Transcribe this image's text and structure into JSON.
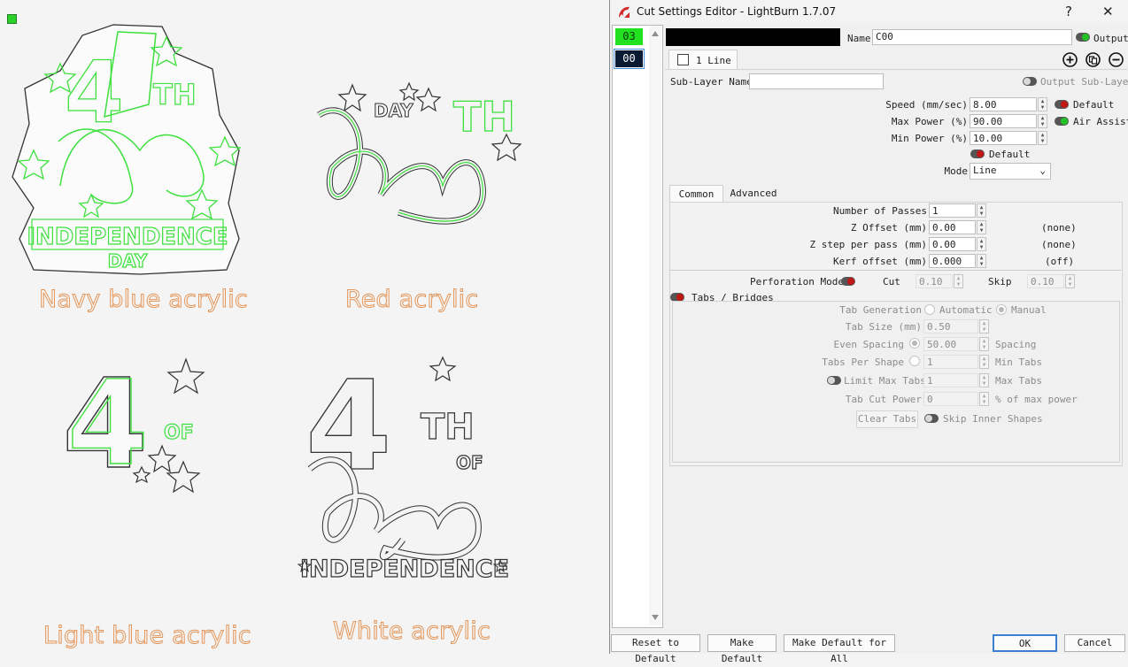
{
  "canvas": {
    "captions": [
      "Navy blue acrylic",
      "Red acrylic",
      "Light blue acrylic",
      "White acrylic"
    ],
    "art": {
      "d1_independence": "INDEPENDENCE",
      "d1_day": "DAY",
      "d1_th": "TH",
      "d2_day": "DAY",
      "d2_th": "TH",
      "d3_of": "OF",
      "d4_th": "TH",
      "d4_of": "OF",
      "d4_independence": "INDEPENDENCE",
      "numeral": "4",
      "script": "July"
    }
  },
  "dialog": {
    "title": "Cut Settings Editor - LightBurn 1.7.07",
    "help_label": "?",
    "close_label": "✕",
    "layers": [
      {
        "label": "03",
        "color": "#22e11f"
      },
      {
        "label": "00",
        "color": "#0a1a33"
      }
    ],
    "name_label": "Name",
    "name_value": "C00",
    "output_label": "Output",
    "sublayer_tab": "1 Line",
    "sublayer_name_label": "Sub-Layer Name",
    "sublayer_name_value": "",
    "output_sublayer_label": "Output Sub-Layer",
    "speed_label": "Speed (mm/sec)",
    "speed_value": "8.00",
    "maxpower_label": "Max Power (%)",
    "maxpower_value": "90.00",
    "minpower_label": "Min Power (%)",
    "minpower_value": "10.00",
    "default_label_1": "Default",
    "air_assist_label": "Air Assist",
    "default_label_2": "Default",
    "mode_label": "Mode",
    "mode_value": "Line",
    "tabs": [
      "Common",
      "Advanced"
    ],
    "passes_label": "Number of Passes",
    "passes_value": "1",
    "zoffset_label": "Z Offset (mm)",
    "zoffset_value": "0.00",
    "zoffset_note": "(none)",
    "zstep_label": "Z step per pass (mm)",
    "zstep_value": "0.00",
    "zstep_note": "(none)",
    "kerf_label": "Kerf offset (mm)",
    "kerf_value": "0.000",
    "kerf_note": "(off)",
    "perf_label": "Perforation Mode",
    "cut_label": "Cut",
    "cut_value": "0.10",
    "skip_label": "Skip",
    "skip_value": "0.10",
    "tabs_bridges_label": "Tabs / Bridges",
    "tabgen_label": "Tab Generation",
    "automatic_label": "Automatic",
    "manual_label": "Manual",
    "tabsize_label": "Tab Size (mm)",
    "tabsize_value": "0.50",
    "evenspacing_label": "Even Spacing",
    "evenspacing_value": "50.00",
    "spacing_label": "Spacing",
    "tabspershape_label": "Tabs Per Shape",
    "tabspershape_value": "1",
    "mintabs_label": "Min Tabs",
    "limitmax_label": "Limit Max Tabs",
    "limitmax_value": "1",
    "maxtabs_label": "Max Tabs",
    "tabcutpower_label": "Tab Cut Power",
    "tabcutpower_value": "0",
    "pct_max_power_label": "% of max power",
    "clear_tabs_label": "Clear Tabs",
    "skip_inner_label": "Skip Inner Shapes",
    "footer": {
      "reset": "Reset to Default",
      "make_default": "Make Default",
      "make_default_all": "Make Default for All",
      "ok": "OK",
      "cancel": "Cancel"
    }
  }
}
